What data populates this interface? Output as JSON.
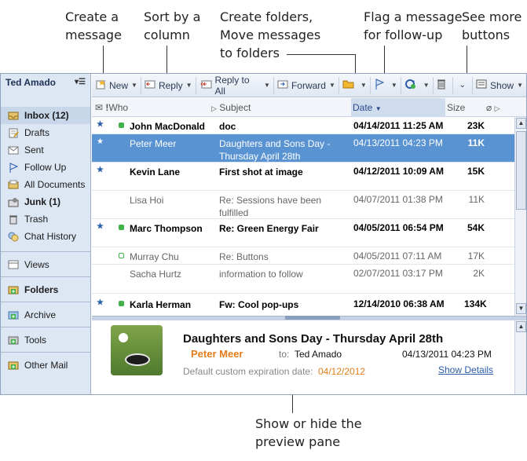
{
  "callouts": {
    "create_message": [
      "Create a",
      "message"
    ],
    "sort_column": [
      "Sort by a",
      "column"
    ],
    "create_folders": [
      "Create folders,",
      "Move messages",
      "to folders"
    ],
    "flag_message": [
      "Flag a message",
      "for follow-up"
    ],
    "see_more": [
      "See more",
      "buttons"
    ],
    "show_hide_preview": [
      "Show or hide the",
      "preview pane"
    ]
  },
  "sidebar": {
    "user": "Ted Amado",
    "items": [
      {
        "label": "Inbox (12)",
        "icon": "inbox-icon"
      },
      {
        "label": "Drafts",
        "icon": "drafts-icon"
      },
      {
        "label": "Sent",
        "icon": "sent-icon"
      },
      {
        "label": "Follow Up",
        "icon": "flag-icon"
      },
      {
        "label": "All Documents",
        "icon": "documents-icon"
      },
      {
        "label": "Junk (1)",
        "icon": "junk-icon"
      },
      {
        "label": "Trash",
        "icon": "trash-icon"
      },
      {
        "label": "Chat History",
        "icon": "chat-icon"
      }
    ],
    "sections": [
      {
        "label": "Views",
        "icon": "views-icon"
      },
      {
        "label": "Folders",
        "icon": "folders-icon"
      },
      {
        "label": "Archive",
        "icon": "archive-icon"
      },
      {
        "label": "Tools",
        "icon": "tools-icon"
      },
      {
        "label": "Other Mail",
        "icon": "other-mail-icon"
      }
    ]
  },
  "toolbar": {
    "new": "New",
    "reply": "Reply",
    "reply_all": "Reply to All",
    "forward": "Forward",
    "show": "Show"
  },
  "list": {
    "headers": {
      "who": "Who",
      "subject": "Subject",
      "date": "Date",
      "size": "Size"
    },
    "rows": [
      {
        "who": "John MacDonald",
        "subject": "doc",
        "date": "04/14/2011 11:25 AM",
        "size": "23K",
        "state": "unread",
        "flag": true,
        "status": true
      },
      {
        "who": "Peter Meer",
        "subject": "Daughters and Sons Day - Thursday April 28th",
        "date": "04/13/2011 04:23 PM",
        "size": "11K",
        "state": "selected",
        "flag": true,
        "status": false
      },
      {
        "who": "Kevin Lane",
        "subject": "First shot at image",
        "date": "04/12/2011 10:09 AM",
        "size": "15K",
        "state": "unread",
        "flag": true,
        "status": false
      },
      {
        "who": "Lisa Hoi",
        "subject": "Re: Sessions have been fulfilled",
        "date": "04/07/2011 01:38 PM",
        "size": "11K",
        "state": "read",
        "flag": false,
        "status": false
      },
      {
        "who": "Marc Thompson",
        "subject": "Re: Green Energy Fair",
        "date": "04/05/2011 06:54 PM",
        "size": "54K",
        "state": "unread",
        "flag": true,
        "status": true
      },
      {
        "who": "Murray  Chu",
        "subject": "Re: Buttons",
        "date": "04/05/2011 07:11 AM",
        "size": "17K",
        "state": "read",
        "flag": false,
        "status": true
      },
      {
        "who": "Sacha Hurtz",
        "subject": "information to follow",
        "date": "02/07/2011 03:17 PM",
        "size": "2K",
        "state": "read",
        "flag": false,
        "status": false
      },
      {
        "who": "Karla Herman",
        "subject": "Fw: Cool pop-ups",
        "date": "12/14/2010 06:38 AM",
        "size": "134K",
        "state": "unread",
        "flag": true,
        "status": true
      }
    ]
  },
  "preview": {
    "subject": "Daughters and Sons Day - Thursday April 28th",
    "from": "Peter Meer",
    "to_label": "to:",
    "to": "Ted Amado",
    "date": "04/13/2011 04:23 PM",
    "expiration_label": "Default custom expiration date:",
    "expiration": "04/12/2012",
    "show_details": "Show Details"
  }
}
